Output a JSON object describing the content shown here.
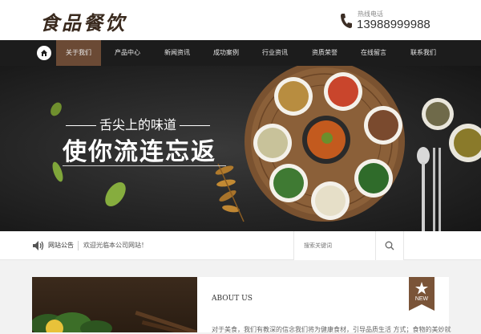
{
  "header": {
    "logo": "食品餐饮",
    "hotline_label": "热线电话",
    "hotline_number": "13988999988"
  },
  "nav": {
    "items": [
      {
        "label": "关于我们",
        "active": true
      },
      {
        "label": "产品中心",
        "active": false
      },
      {
        "label": "新闻资讯",
        "active": false
      },
      {
        "label": "成功案例",
        "active": false
      },
      {
        "label": "行业资讯",
        "active": false
      },
      {
        "label": "资质荣誉",
        "active": false
      },
      {
        "label": "在线留言",
        "active": false
      },
      {
        "label": "联系我们",
        "active": false
      }
    ]
  },
  "banner": {
    "subtitle": "舌尖上的味道",
    "title": "使你流连忘返"
  },
  "notice": {
    "label": "网站公告",
    "text": "欢迎光临本公司网站！",
    "search_placeholder": "搜索关键词"
  },
  "about": {
    "title": "ABOUT US",
    "badge": "NEW",
    "text": "对于美食，我们有教深的信念我们将为健康食材，引导品质生活 方式；食物的美妙就"
  },
  "colors": {
    "nav_bg": "#1c1c1c",
    "nav_active": "#6b4a35",
    "accent_brown": "#7a5438"
  }
}
